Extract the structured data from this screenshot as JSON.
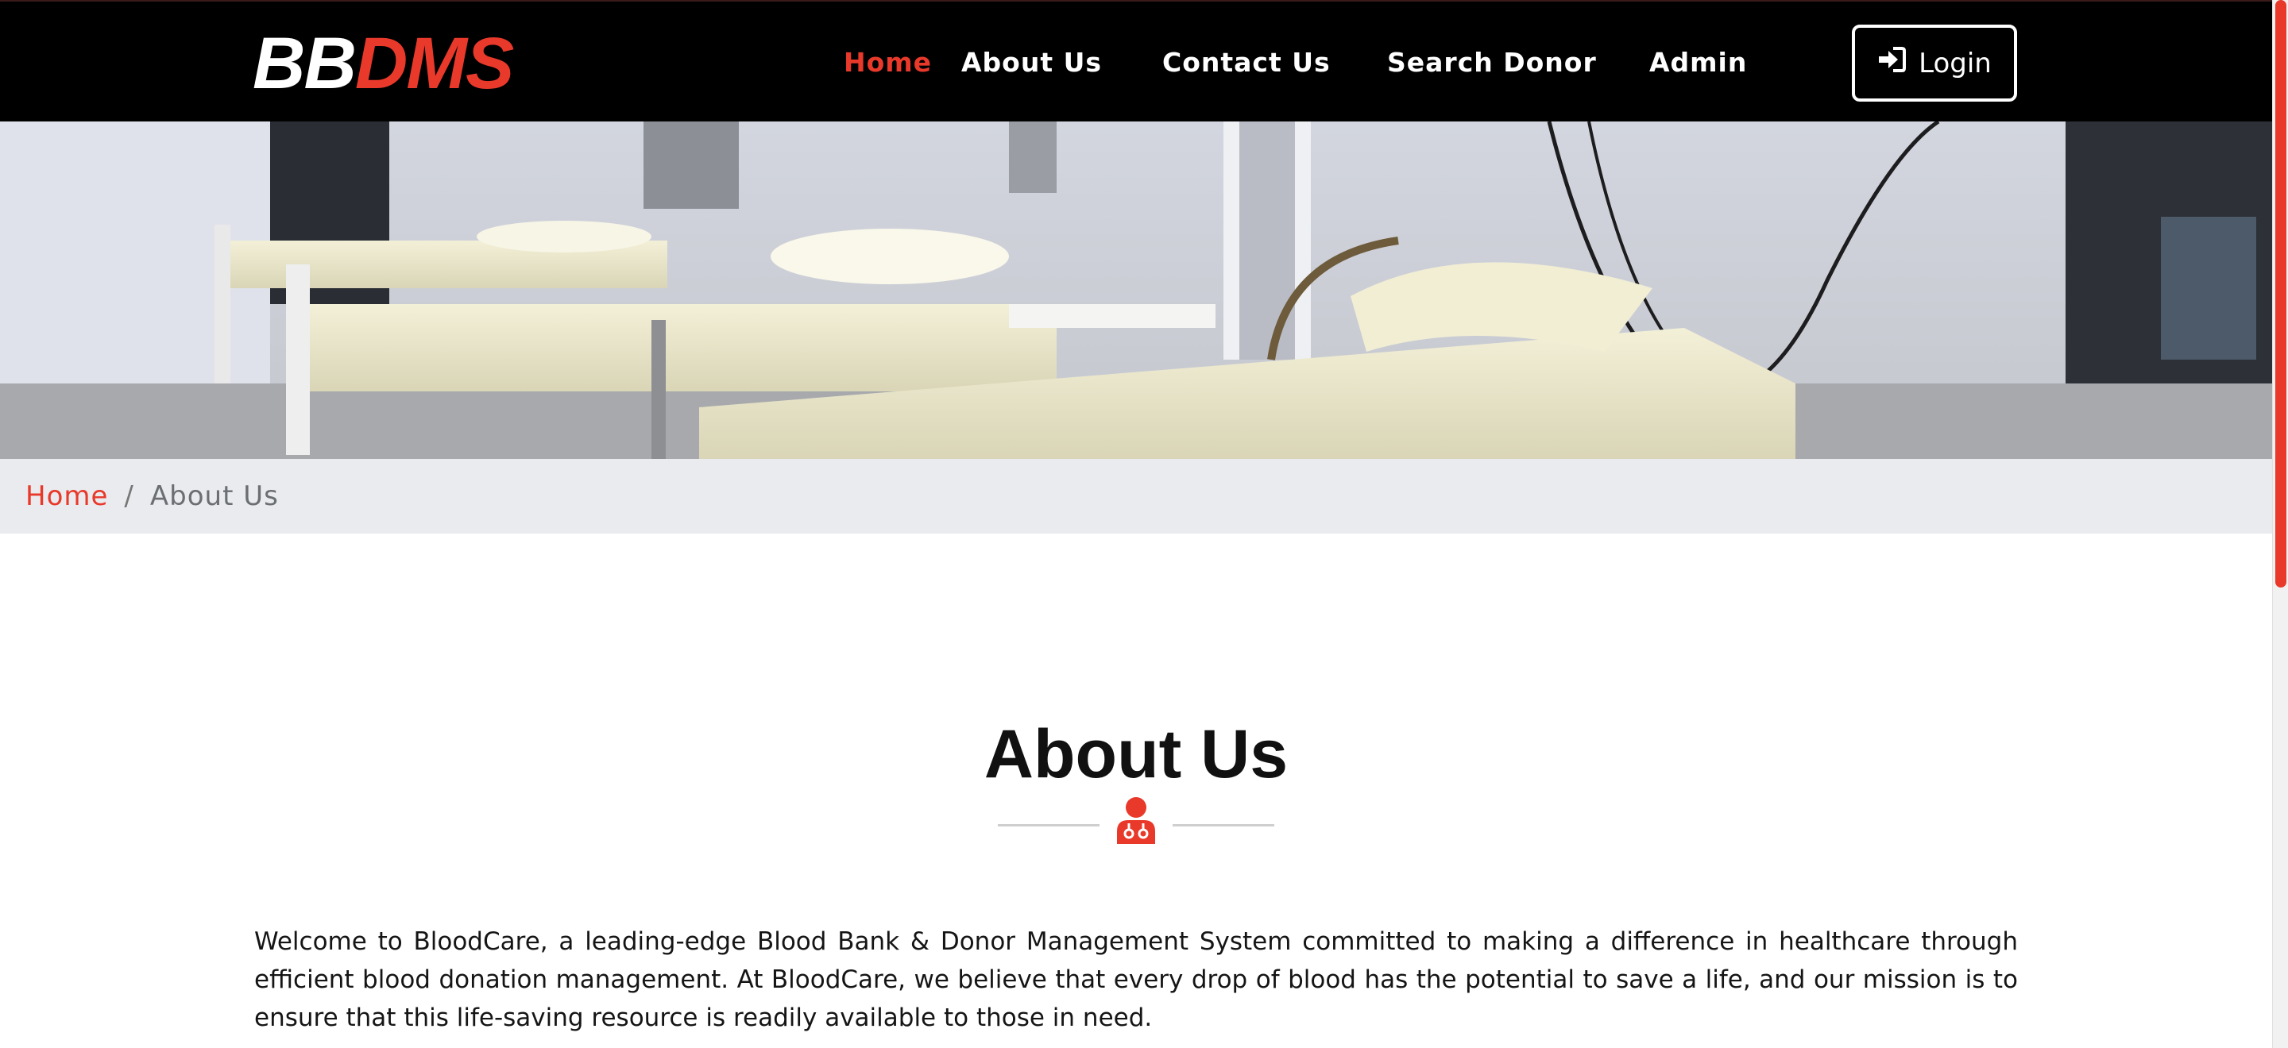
{
  "navbar": {
    "brand_part1": "BB",
    "brand_part2": "DMS",
    "links": [
      {
        "label": "Home",
        "active": true
      },
      {
        "label": "About Us",
        "active": false
      },
      {
        "label": "Contact Us",
        "active": false
      },
      {
        "label": "Search Donor",
        "active": false
      },
      {
        "label": "Admin",
        "active": false
      }
    ],
    "login_label": "Login",
    "login_icon": "sign-in-icon"
  },
  "breadcrumb": {
    "home": "Home",
    "separator": "/",
    "current": "About Us"
  },
  "section": {
    "title": "About Us",
    "divider_icon": "user-doctor-icon",
    "paragraph": "Welcome to BloodCare, a leading-edge Blood Bank & Donor Management System committed to making a difference in healthcare through efficient blood donation management. At BloodCare, we believe that every drop of blood has the potential to save a life, and our mission is to ensure that this life-saving resource is readily available to those in need."
  },
  "colors": {
    "accent": "#e8392b",
    "navbar_bg": "#000000",
    "breadcrumb_bg": "#e9ebee"
  }
}
